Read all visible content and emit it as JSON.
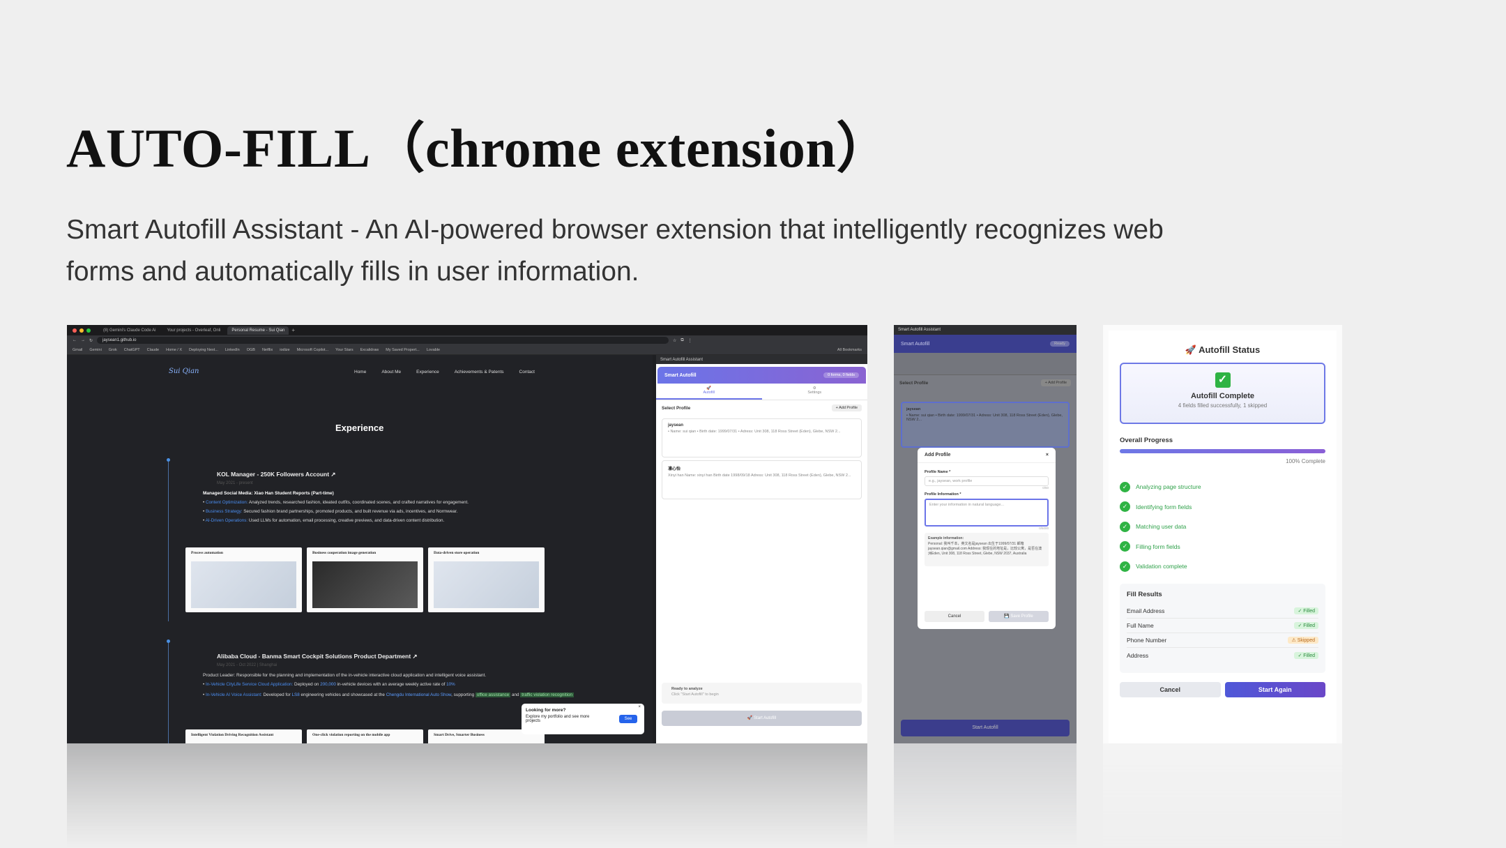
{
  "slide": {
    "title": "AUTO-FILL（chrome extension）",
    "description": "Smart Autofill Assistant - An AI-powered browser extension that intelligently recognizes web forms and automatically fills in user information."
  },
  "browser": {
    "tabs": [
      "(8) Gemini's Claude Code Ai",
      "Your projects - Overleaf, Onli",
      "Personal Resume - Sui Qian"
    ],
    "url": "jaysean1.github.io",
    "bookmarks": [
      "Gmail",
      "Gemini",
      "Grok",
      "ChatGPT",
      "Claude",
      "Home / X",
      "Deploying Next...",
      "LinkedIn",
      "OGB",
      "Netflix",
      "iodize",
      "Microsoft Copilot...",
      "Your Stars",
      "Excalidraw",
      "My Saved Propert...",
      "Lovable",
      "All Bookmarks"
    ],
    "site": {
      "logo": "Sui Qian",
      "nav": [
        "Home",
        "About Me",
        "Experience",
        "Achievements & Patents",
        "Contact"
      ],
      "section_title": "Experience",
      "job1": {
        "title": "KOL Manager - 250K Followers Account ↗",
        "date": "May 2021 - present",
        "lead": "Managed Social Media: Xiao Han Student Reports (Part-time)",
        "bullets": [
          {
            "k": "Content Optimization:",
            "v": " Analyzed trends, researched fashion, ideated outfits, coordinated scenes, and crafted narratives for engagement."
          },
          {
            "k": "Business Strategy:",
            "v": " Secured fashion brand partnerships, promoted products, and built revenue via ads, incentives, and Normwear."
          },
          {
            "k": "AI-Driven Operations:",
            "v": " Used LLMs for automation, email processing, creative previews, and data-driven content distribution."
          }
        ],
        "cards": [
          "Process automation",
          "Business cooperation image generation",
          "Data-driven store operation"
        ]
      },
      "job2": {
        "title": "Alibaba Cloud - Banma Smart Cockpit Solutions Product Department ↗",
        "date": "May 2021 - Oct 2022 | Shanghai",
        "lead": "Product Leader: Responsible for the planning and implementation of the in-vehicle interactive cloud application and intelligent voice assistant.",
        "b1k": "In-Vehicle CityLife Service Cloud Application:",
        "b1a": " Deployed on ",
        "b1n": "200,000",
        "b1b": " in-vehicle devices with an average weekly active rate of ",
        "b1p": "10%",
        "b2k": "In-Vehicle AI Voice Assistant:",
        "b2a": " Developed for ",
        "b2n": "LS8",
        "b2b": " engineering vehicles and showcased at the ",
        "b2c": "Chengdu International Auto Show",
        "b2d": ", supporting ",
        "b2e": "office assistance",
        "b2f": " and ",
        "b2g": "traffic violation recognition",
        "cards": [
          "Intelligent Violation Driving Recognition Assistant",
          "One-click violation reporting on the mobile app",
          "Smart Drive, Smarter Business"
        ]
      },
      "toast": {
        "title": "Looking for more?",
        "text": "Explore my portfolio and see more projects",
        "button": "See"
      }
    },
    "panel": {
      "window_title": "Smart Autofill Assistant",
      "header": "Smart Autofill",
      "status": "0 forms, 0 fields",
      "tabs": [
        "Autofill",
        "Settings"
      ],
      "section": "Select Profile",
      "add_btn": "+ Add Profile",
      "profiles": [
        {
          "name": "jaysean",
          "text": "• Name: sui qian • Birth date: 1999/07/31 • Adress: Unit 308, 118 Ross Street (Eden), Glebe, NSW 2..."
        },
        {
          "name": "凛心怡",
          "text": "Xinyi han Name: xinyi han Birth date 1998/09/18 Adress: Unit 308, 118 Ross Street (Eden), Glebe, NSW 2..."
        }
      ],
      "ready_title": "Ready to analyze",
      "ready_sub": "Click \"Start Autofill\" to begin",
      "start": "🚀 Start Autofill"
    }
  },
  "dialog_shot": {
    "window_title": "Smart Autofill Assistant",
    "header": "Smart Autofill",
    "status": "Ready",
    "section": "Select Profile",
    "add_btn": "+ Add Profile",
    "profile_name": "jaysean",
    "profile_text": "• Name: sui qian • Birth date: 1999/07/31 • Adress: Unit 308, 118 Ross Street (Eden), Glebe, NSW 2...",
    "dialog": {
      "title": "Add Profile",
      "name_label": "Profile Name *",
      "name_placeholder": "e.g., jaysean, work profile",
      "name_count": "0/50",
      "info_label": "Profile Information *",
      "info_placeholder": "Enter your information in natural language...",
      "info_count": "0/5000",
      "example_title": "Example information:",
      "example_text": "Personal: 我叫千本，英文名是jaysean 出生于1999/07/31 邮箱 jaysean.qian@gmail.com  Address: 我现在的地址是，比较公寓，是否在澳洲Eden, Unit 308, 118 Ross Street, Glebe, NSW 2037, Australia",
      "cancel": "Cancel",
      "save": "💾 Save Profile"
    },
    "start": "Start Autofill"
  },
  "status_shot": {
    "title": "🚀 Autofill Status",
    "complete_title": "Autofill Complete",
    "complete_sub": "4 fields filled successfully, 1 skipped",
    "overall": "Overall Progress",
    "progress": 1.0,
    "progress_label": "100% Complete",
    "steps": [
      "Analyzing page structure",
      "Identifying form fields",
      "Matching user data",
      "Filling form fields",
      "Validation complete"
    ],
    "results_title": "Fill Results",
    "results": [
      {
        "field": "Email Address",
        "status": "✓ Filled"
      },
      {
        "field": "Full Name",
        "status": "✓ Filled"
      },
      {
        "field": "Phone Number",
        "status": "⚠ Skipped"
      },
      {
        "field": "Address",
        "status": "✓ Filled"
      }
    ],
    "cancel": "Cancel",
    "again": "Start Again"
  }
}
